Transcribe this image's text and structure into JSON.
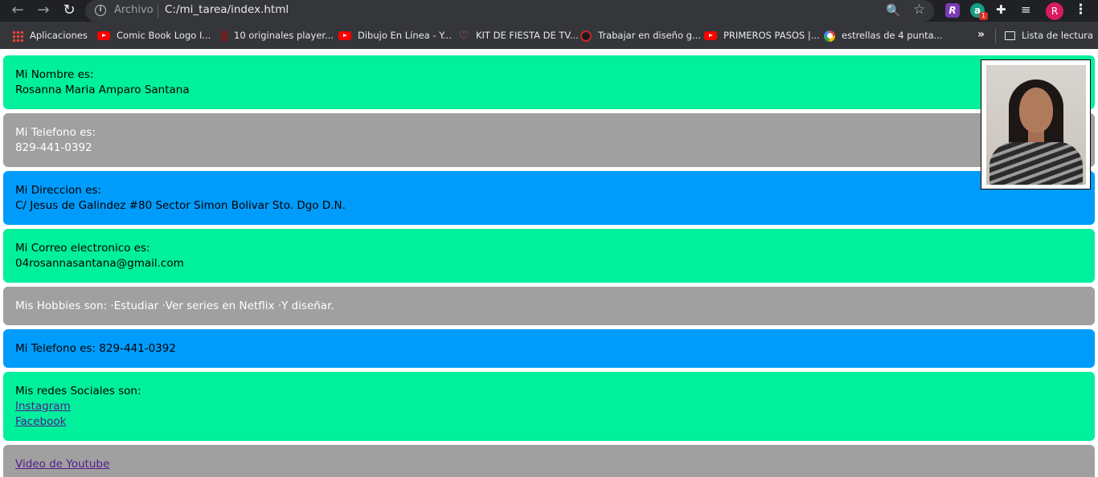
{
  "browser": {
    "scheme_label": "Archivo",
    "url": "C:/mi_tarea/index.html",
    "nav": {
      "back": "←",
      "forward": "→",
      "reload": "↻"
    },
    "icons": {
      "info": "i",
      "zoom": "🔍",
      "star": "☆",
      "puzzle": "✚",
      "media": "≡",
      "menu": "⋮",
      "chevrons": "»",
      "heart": "♡"
    },
    "extensions": [
      {
        "name": "extension-r",
        "glyph": "R"
      },
      {
        "name": "extension-grammarly",
        "glyph": "a",
        "badge": "1"
      }
    ],
    "profile_initial": "R",
    "bookmarks": [
      {
        "label": "Aplicaciones",
        "icon": "apps-grid-icon"
      },
      {
        "label": "Comic Book Logo I...",
        "icon": "youtube-icon"
      },
      {
        "label": "10 originales player...",
        "icon": "pinterest-icon"
      },
      {
        "label": "Dibujo En Línea - Y...",
        "icon": "youtube-icon"
      },
      {
        "label": "KIT DE FIESTA DE TV...",
        "icon": "heart-icon"
      },
      {
        "label": "Trabajar en diseño g...",
        "icon": "behance-icon"
      },
      {
        "label": "PRIMEROS PASOS |...",
        "icon": "youtube-icon"
      },
      {
        "label": "estrellas de 4 punta...",
        "icon": "google-icon"
      }
    ],
    "reading_list": "Lista de lectura"
  },
  "profile": {
    "name_label": "Mi Nombre es:",
    "name": "Rosanna Maria Amparo Santana",
    "phone_label": "Mi Telefono es:",
    "phone": "829-441-0392",
    "address_label": "Mi Direccion es:",
    "address": "C/ Jesus de Galindez #80 Sector Simon Bolivar Sto. Dgo D.N.",
    "email_label": "Mi Correo electronico es:",
    "email": "04rosannasantana@gmail.com",
    "hobbies": "Mis Hobbies son: ·Estudiar ·Ver series en Netflix ·Y diseñar.",
    "phone_inline": "Mi Telefono es: 829-441-0392",
    "socials_label": "Mis redes Sociales son:",
    "socials": [
      "Instagram",
      "Facebook"
    ],
    "video_link": "Video de Youtube"
  },
  "colors": {
    "green": "#00f09c",
    "grey": "#a0a0a0",
    "blue": "#009cfc",
    "link": "#551a8b"
  }
}
